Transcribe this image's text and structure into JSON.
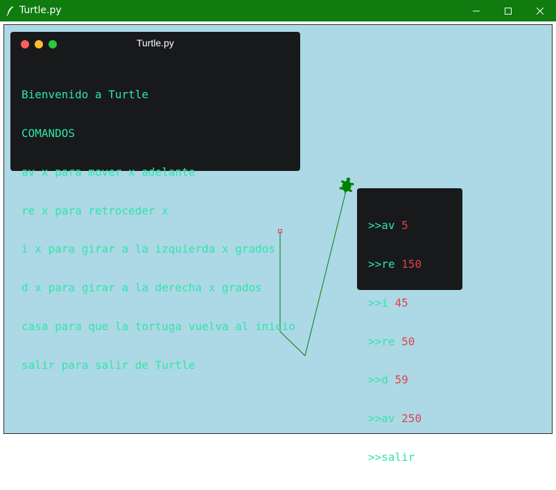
{
  "window": {
    "title": "Turtle.py",
    "app_icon": "feather-quill-icon",
    "controls": [
      "minimize-icon",
      "maximize-icon",
      "close-icon"
    ],
    "titlebar_color": "#107c10"
  },
  "canvas": {
    "background": "#add8e6",
    "line_color": "#008000",
    "start_marker_color": "#e0414b",
    "turtle_color": "#008000"
  },
  "help_panel": {
    "title": "Turtle.py",
    "dots": [
      "#ff5f56",
      "#ffbd2e",
      "#27c93f"
    ],
    "lines": [
      "Bienvenido a Turtle",
      "COMANDOS",
      "av x para mover x adelante",
      "re x para retroceder x",
      "i x para girar a la izquierda x grados",
      "d x para girar a la derecha x grados",
      "casa para que la tortuga vuelva al inicio",
      "salir para salir de Turtle"
    ]
  },
  "history_panel": {
    "entries": [
      {
        "prompt": ">>av",
        "arg": "5"
      },
      {
        "prompt": ">>re",
        "arg": "150"
      },
      {
        "prompt": ">>i",
        "arg": "45"
      },
      {
        "prompt": ">>re",
        "arg": "50"
      },
      {
        "prompt": ">>d",
        "arg": "59"
      },
      {
        "prompt": ">>av",
        "arg": "250"
      },
      {
        "prompt": ">>salir",
        "arg": ""
      }
    ]
  }
}
